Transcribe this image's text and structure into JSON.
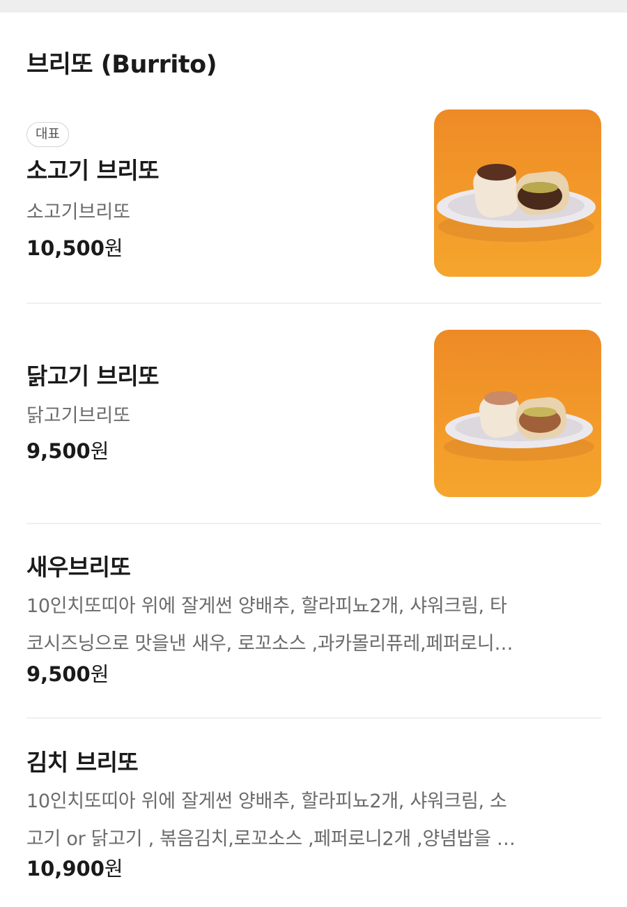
{
  "section": {
    "title": "브리또 (Burrito)"
  },
  "items": [
    {
      "badge": "대표",
      "name": "소고기 브리또",
      "desc": "소고기브리또",
      "price": "10,500",
      "currency": "원",
      "image_icon": "beef-burrito-photo"
    },
    {
      "name": "닭고기 브리또",
      "desc": "닭고기브리또",
      "price": "9,500",
      "currency": "원",
      "image_icon": "chicken-burrito-photo"
    },
    {
      "name": "새우브리또",
      "desc_lines": [
        "10인치또띠아 위에 잘게썬 양배추, 할라피뇨2개, 샤워크림, 타",
        "코시즈닝으로 맛을낸 새우, 로꼬소스 ,과카몰리퓨레,페퍼로니…"
      ],
      "price": "9,500",
      "currency": "원"
    },
    {
      "name": "김치 브리또",
      "desc_lines": [
        "10인치또띠아 위에 잘게썬 양배추, 할라피뇨2개, 샤워크림, 소",
        "고기 or 닭고기 , 볶음김치,로꼬소스 ,페퍼로니2개 ,양념밥을 …"
      ],
      "price": "10,900",
      "currency": "원"
    }
  ],
  "colors": {
    "image_background": "#f0922a",
    "divider": "#efefef",
    "secondary_text": "#6b6b6b"
  }
}
